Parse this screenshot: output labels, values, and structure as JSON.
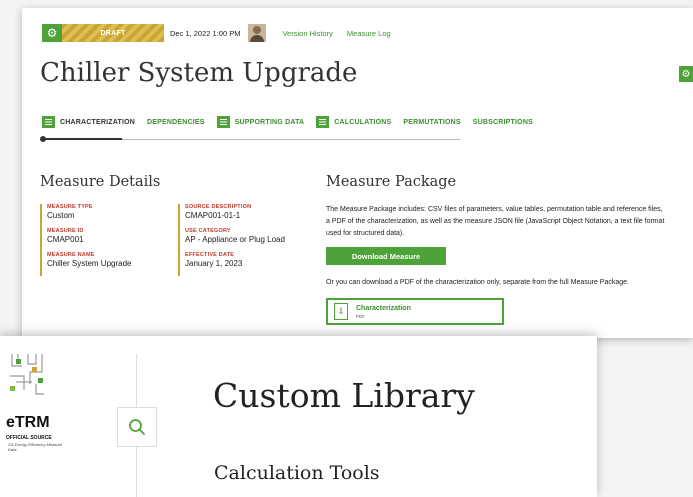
{
  "measure": {
    "status_badge": "DRAFT",
    "date": "Dec 1, 2022 1:00 PM",
    "links": [
      "Version History",
      "Measure Log"
    ],
    "title": "Chiller System Upgrade",
    "tabs": [
      {
        "label": "CHARACTERIZATION",
        "icon": "document-icon"
      },
      {
        "label": "DEPENDENCIES",
        "icon": ""
      },
      {
        "label": "SUPPORTING DATA",
        "icon": "document-icon"
      },
      {
        "label": "CALCULATIONS",
        "icon": "document-icon"
      },
      {
        "label": "PERMUTATIONS",
        "icon": ""
      },
      {
        "label": "SUBSCRIPTIONS",
        "icon": ""
      }
    ],
    "details": {
      "heading": "Measure Details",
      "left": [
        {
          "label": "MEASURE TYPE",
          "value": "Custom"
        },
        {
          "label": "MEASURE ID",
          "value": "CMAP001"
        },
        {
          "label": "MEASURE NAME",
          "value": "Chiller System Upgrade"
        }
      ],
      "right": [
        {
          "label": "SOURCE DESCRIPTION",
          "value": "CMAP001-01-1"
        },
        {
          "label": "USE CATEGORY",
          "value": "AP - Appliance or Plug Load"
        },
        {
          "label": "EFFECTIVE DATE",
          "value": "January 1, 2023"
        }
      ]
    },
    "package": {
      "heading": "Measure Package",
      "description": "The Measure Package includes: CSV files of parameters, value tables, permutation table and reference files, a PDF of the characterization, as well as the measure JSON file (JavaScript Object Notation, a text file format used for structured data).",
      "download_label": "Download Measure",
      "or_text": "Or you can download a PDF of the characterization only, separate from the full Measure Package.",
      "char_label": "Characterization",
      "char_sub": "PDF"
    }
  },
  "library": {
    "logo_name": "eTRM",
    "logo_official": "OFFICIAL SOURCE",
    "logo_tagline": "CA Energy Efficiency Measure Data",
    "title": "Custom Library",
    "subtitle": "Calculation Tools"
  },
  "colors": {
    "brand_green": "#4fa23a",
    "draft_gold": "#c9a634",
    "label_red": "#c0392b"
  }
}
